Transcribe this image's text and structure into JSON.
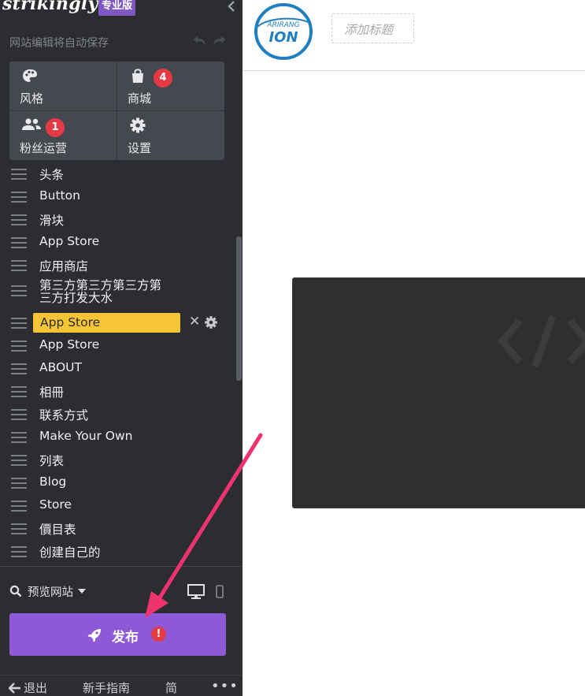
{
  "sidebar": {
    "brand": "strikingly",
    "plan_badge": "专业版",
    "autosave_text": "网站编辑将自动保存",
    "tiles": [
      {
        "label": "风格",
        "icon": "palette-icon",
        "badge": ""
      },
      {
        "label": "商城",
        "icon": "shopping-bag-icon",
        "badge": "4"
      },
      {
        "label": "粉丝运营",
        "icon": "users-icon",
        "badge": "1"
      },
      {
        "label": "设置",
        "icon": "gear-icon",
        "badge": ""
      }
    ],
    "pages": [
      {
        "label": "头条"
      },
      {
        "label": "Button"
      },
      {
        "label": "滑块"
      },
      {
        "label": "App Store"
      },
      {
        "label": "应用商店"
      },
      {
        "label": "第三方第三方第三方第三方打发大水"
      },
      {
        "label": "App Store",
        "active": true
      },
      {
        "label": "App Store"
      },
      {
        "label": "ABOUT"
      },
      {
        "label": "相冊"
      },
      {
        "label": "联系方式"
      },
      {
        "label": "Make Your Own"
      },
      {
        "label": "列表"
      },
      {
        "label": "Blog"
      },
      {
        "label": "Store"
      },
      {
        "label": "價目表"
      },
      {
        "label": "创建自己的"
      }
    ],
    "preview_label": "预览网站",
    "publish_label": "发布",
    "publish_alert": "!",
    "footer": {
      "exit": "退出",
      "guide": "新手指南",
      "language": "简",
      "more": "•••"
    }
  },
  "main": {
    "logo": {
      "top_text": "ARIRANG",
      "bottom_text": "ION"
    },
    "title_placeholder": "添加标题"
  },
  "colors": {
    "sidebar_bg": "#2b2d31",
    "tile_bg": "#45484e",
    "active_page": "#f6c535",
    "publish": "#8e59d6",
    "badge": "#e53946",
    "arrow": "#f0326e",
    "logo_blue": "#1f7fc1"
  }
}
